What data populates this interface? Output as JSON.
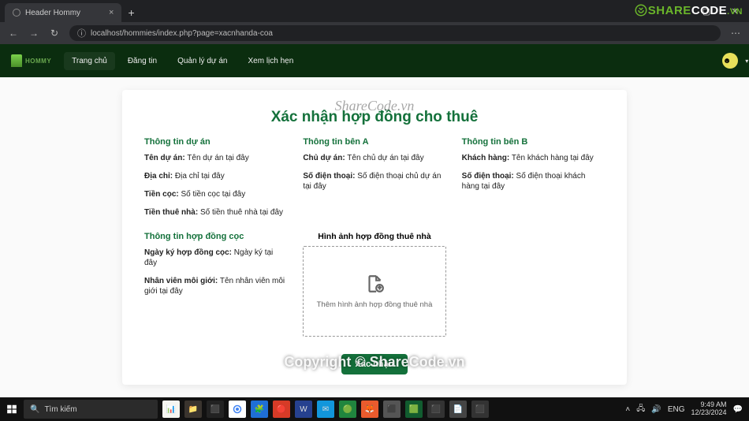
{
  "browser": {
    "tab_title": "Header Hommy",
    "url": "localhost/hommies/index.php?page=xacnhanda-coa"
  },
  "watermarks": {
    "top": "ShareCode.vn",
    "bottom": "Copyright © ShareCode.vn",
    "badge_a": "SHARE",
    "badge_b": "CODE",
    "badge_vn": ".VN"
  },
  "nav": {
    "brand": "HOMMY",
    "items": [
      "Trang chủ",
      "Đăng tin",
      "Quản lý dự án",
      "Xem lịch hẹn"
    ]
  },
  "page": {
    "title": "Xác nhận hợp đồng cho thuê",
    "project_section": {
      "heading": "Thông tin dự án",
      "name_label": "Tên dự án:",
      "name_value": "Tên dự án tại đây",
      "addr_label": "Địa chỉ:",
      "addr_value": "Địa chỉ tại đây",
      "deposit_label": "Tiền cọc:",
      "deposit_value": "Số tiền cọc tại đây",
      "rent_label": "Tiền thuê nhà:",
      "rent_value": "Số tiền thuê nhà tại đây"
    },
    "party_a": {
      "heading": "Thông tin bên A",
      "owner_label": "Chủ dự án:",
      "owner_value": "Tên chủ dự án tại đây",
      "phone_label": "Số điện thoại:",
      "phone_value": "Số điện thoại chủ dự án tại đây"
    },
    "party_b": {
      "heading": "Thông tin bên B",
      "cust_label": "Khách hàng:",
      "cust_value": "Tên khách hàng tại đây",
      "phone_label": "Số điện thoại:",
      "phone_value": "Số điện thoại khách hàng tại đây"
    },
    "deposit_contract": {
      "heading": "Thông tin hợp đồng cọc",
      "date_label": "Ngày ký hợp đồng cọc:",
      "date_value": "Ngày ký tại đây",
      "agent_label": "Nhân viên môi giới:",
      "agent_value": "Tên nhân viên môi giới tại đây"
    },
    "upload": {
      "heading": "Hình ảnh hợp đồng thuê nhà",
      "placeholder": "Thêm hình ảnh hợp đồng thuê nhà"
    },
    "confirm_label": "Xác nhận"
  },
  "taskbar": {
    "search_placeholder": "Tìm kiếm",
    "lang": "ENG",
    "time": "9:49 AM",
    "date": "12/23/2024"
  }
}
